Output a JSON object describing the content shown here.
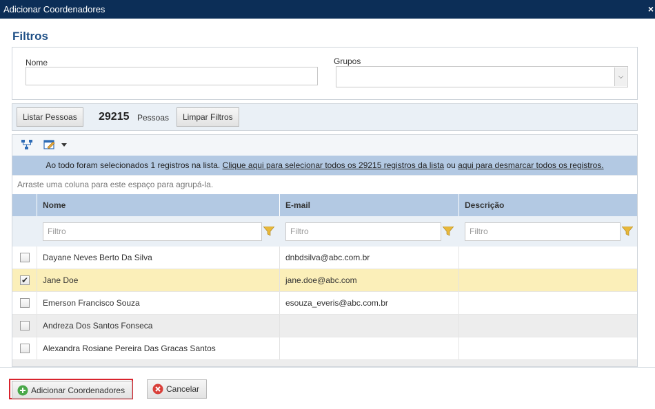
{
  "window": {
    "title": "Adicionar Coordenadores",
    "close_label": "×"
  },
  "filters": {
    "title": "Filtros",
    "nome_label": "Nome",
    "nome_value": "",
    "grupos_label": "Grupos",
    "grupos_value": ""
  },
  "toolbar": {
    "listar_label": "Listar Pessoas",
    "count": "29215",
    "count_label": "Pessoas",
    "limpar_label": "Limpar Filtros"
  },
  "grid": {
    "banner_prefix": "Ao todo foram selecionados 1 registros na lista.",
    "banner_link1": "Clique aqui para selecionar todos os 29215 registros da lista",
    "banner_mid": "ou",
    "banner_link2": "aqui para desmarcar todos os registros.",
    "group_hint": "Arraste uma coluna para este espaço para agrupá-la.",
    "columns": [
      "Nome",
      "E-mail",
      "Descrição"
    ],
    "filter_placeholder": "Filtro",
    "rows": [
      {
        "nome": "Dayane Neves Berto Da Silva",
        "email": "dnbdsilva@abc.com.br",
        "descricao": "",
        "checked": false
      },
      {
        "nome": "Jane Doe",
        "email": "jane.doe@abc.com",
        "descricao": "",
        "checked": true
      },
      {
        "nome": "Emerson Francisco Souza",
        "email": "esouza_everis@abc.com.br",
        "descricao": "",
        "checked": false
      },
      {
        "nome": "Andreza Dos Santos Fonseca",
        "email": "",
        "descricao": "",
        "checked": false
      },
      {
        "nome": "Alexandra Rosiane Pereira Das Gracas Santos",
        "email": "",
        "descricao": "",
        "checked": false
      }
    ],
    "check_mark": "✔"
  },
  "footer": {
    "add_label": "Adicionar Coordenadores",
    "cancel_label": "Cancelar"
  },
  "colors": {
    "titlebar": "#0c2e57",
    "header": "#b3c9e3",
    "selected_row": "#fbefb9",
    "alt_row": "#ededed",
    "accent_title": "#1e4f86",
    "highlight_border": "#d9232d"
  }
}
